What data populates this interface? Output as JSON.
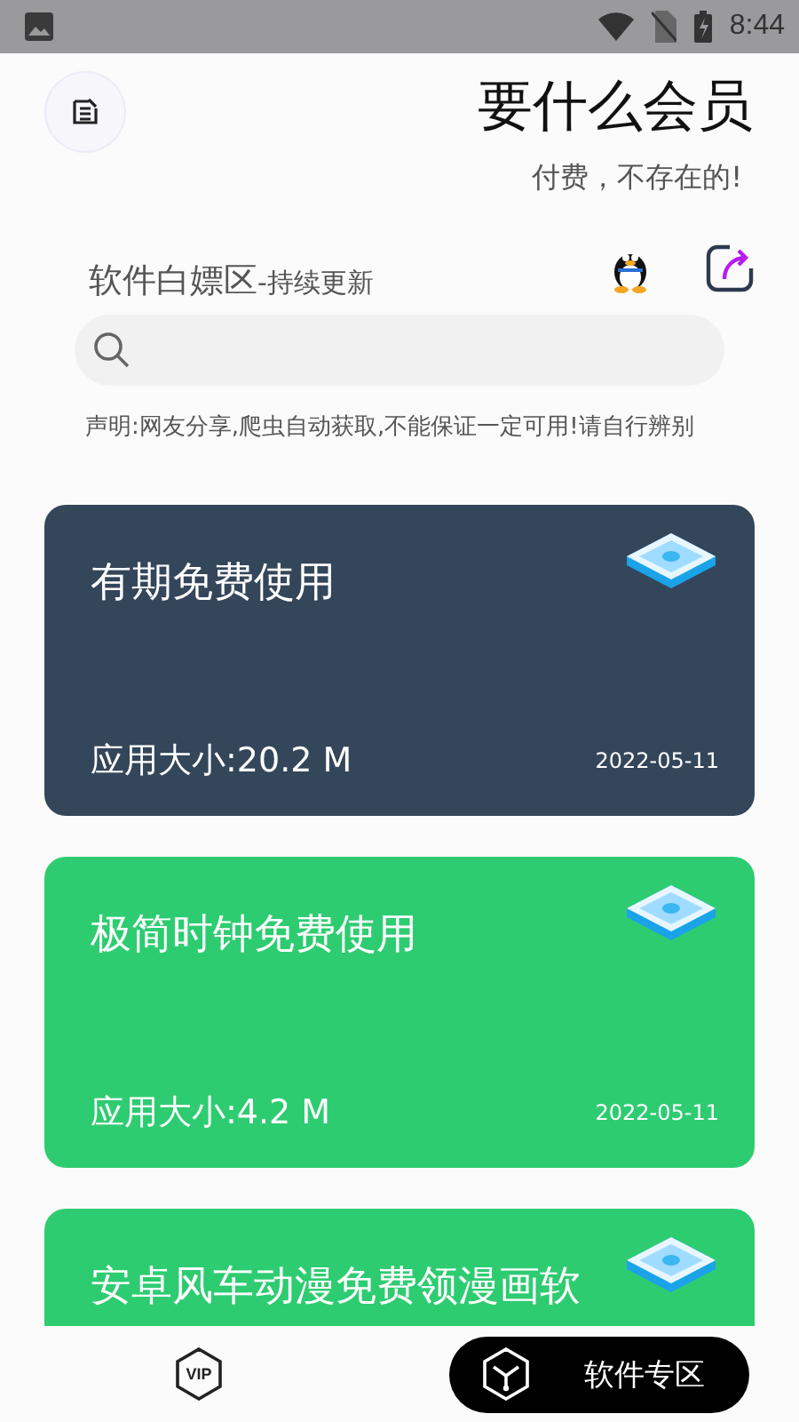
{
  "status_bar": {
    "time": "8:44"
  },
  "header": {
    "title": "要什么会员",
    "subtitle": "付费，不存在的!"
  },
  "section": {
    "title": "软件白嫖区",
    "suffix": "-持续更新"
  },
  "notice": "声明:网友分享,爬虫自动获取,不能保证一定可用!请自行辨别",
  "cards": [
    {
      "title": "有期免费使用",
      "size": "应用大小:20.2 M",
      "date": "2022-05-11",
      "color": "#34465a"
    },
    {
      "title": "极简时钟免费使用",
      "size": "应用大小:4.2 M",
      "date": "2022-05-11",
      "color": "#2ecc71"
    },
    {
      "title": "安卓风车动漫免费领漫画软",
      "color": "#2ecc71"
    }
  ],
  "bottom_nav": {
    "vip_label": "VIP",
    "button_label": "软件专区"
  }
}
